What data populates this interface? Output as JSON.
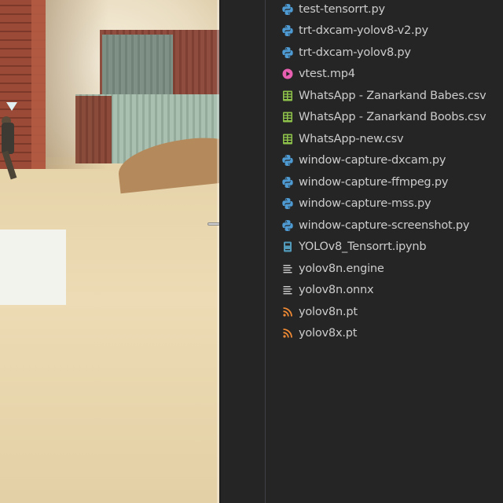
{
  "colors": {
    "explorer_bg": "#252526",
    "text": "#cccccc",
    "python_icon": "#4e9bd4",
    "mp4_icon": "#e85fb2",
    "csv_icon": "#8dc149",
    "notebook_icon": "#519aba",
    "text_file_icon": "#cccccc",
    "rss_icon": "#f08a34"
  },
  "explorer": {
    "files": [
      {
        "name": "test-tensorrt.py",
        "icon": "python-icon"
      },
      {
        "name": "trt-dxcam-yolov8-v2.py",
        "icon": "python-icon"
      },
      {
        "name": "trt-dxcam-yolov8.py",
        "icon": "python-icon"
      },
      {
        "name": "vtest.mp4",
        "icon": "video-icon"
      },
      {
        "name": "WhatsApp - Zanarkand Babes.csv",
        "icon": "csv-table-icon"
      },
      {
        "name": "WhatsApp - Zanarkand Boobs.csv",
        "icon": "csv-table-icon"
      },
      {
        "name": "WhatsApp-new.csv",
        "icon": "csv-table-icon"
      },
      {
        "name": "window-capture-dxcam.py",
        "icon": "python-icon"
      },
      {
        "name": "window-capture-ffmpeg.py",
        "icon": "python-icon"
      },
      {
        "name": "window-capture-mss.py",
        "icon": "python-icon"
      },
      {
        "name": "window-capture-screenshot.py",
        "icon": "python-icon"
      },
      {
        "name": "YOLOv8_Tensorrt.ipynb",
        "icon": "notebook-icon"
      },
      {
        "name": "yolov8n.engine",
        "icon": "text-file-icon"
      },
      {
        "name": "yolov8n.onnx",
        "icon": "text-file-icon"
      },
      {
        "name": "yolov8n.pt",
        "icon": "rss-feed-icon"
      },
      {
        "name": "yolov8x.pt",
        "icon": "rss-feed-icon"
      }
    ]
  }
}
